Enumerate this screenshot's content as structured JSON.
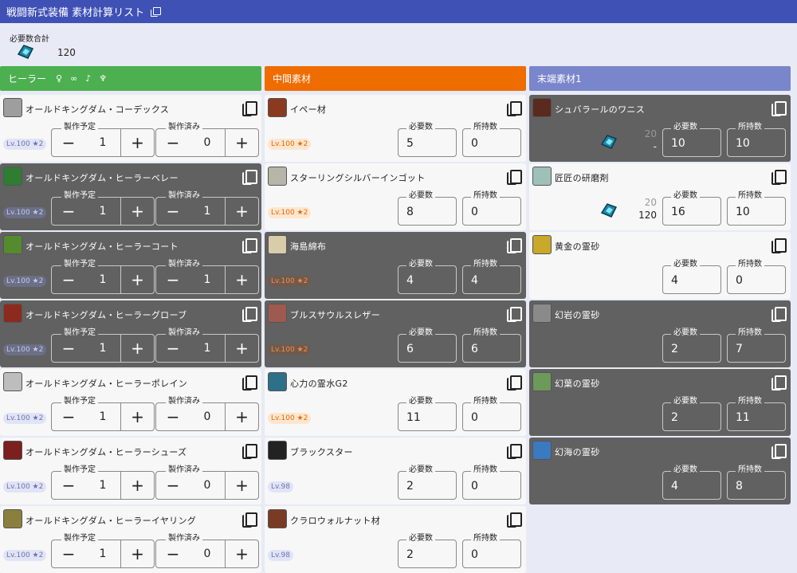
{
  "header": {
    "title": "戦闘新式装備 素材計算リスト"
  },
  "total": {
    "label": "必要数合計",
    "value": "120",
    "icon": "crystal-icon"
  },
  "columns": [
    {
      "title": "ヒーラー",
      "icons": [
        "white-mage-icon",
        "astrologian-icon",
        "sage-icon",
        "scholar-icon"
      ],
      "color": "#4caf50"
    },
    {
      "title": "中間素材",
      "color": "#ef6c00"
    },
    {
      "title": "末端素材1",
      "color": "#7986cb"
    }
  ],
  "gear": [
    {
      "name": "オールドキングダム・コーデックス",
      "level": "Lv.100 ★2",
      "plan_label": "製作予定",
      "plan": "1",
      "done_label": "製作済み",
      "done": "0"
    },
    {
      "name": "オールドキングダム・ヒーラーベレー",
      "level": "Lv.100 ★2",
      "plan_label": "製作予定",
      "plan": "1",
      "done_label": "製作済み",
      "done": "1"
    },
    {
      "name": "オールドキングダム・ヒーラーコート",
      "level": "Lv.100 ★2",
      "plan_label": "製作予定",
      "plan": "1",
      "done_label": "製作済み",
      "done": "1"
    },
    {
      "name": "オールドキングダム・ヒーラーグローブ",
      "level": "Lv.100 ★2",
      "plan_label": "製作予定",
      "plan": "1",
      "done_label": "製作済み",
      "done": "1"
    },
    {
      "name": "オールドキングダム・ヒーラーポレイン",
      "level": "Lv.100 ★2",
      "plan_label": "製作予定",
      "plan": "1",
      "done_label": "製作済み",
      "done": "0"
    },
    {
      "name": "オールドキングダム・ヒーラーシューズ",
      "level": "Lv.100 ★2",
      "plan_label": "製作予定",
      "plan": "1",
      "done_label": "製作済み",
      "done": "0"
    },
    {
      "name": "オールドキングダム・ヒーラーイヤリング",
      "level": "Lv.100 ★2",
      "plan_label": "製作予定",
      "plan": "1",
      "done_label": "製作済み",
      "done": "0"
    }
  ],
  "intermediate": [
    {
      "name": "イペー材",
      "level": "Lv.100 ★2",
      "need_label": "必要数",
      "need": "5",
      "have_label": "所持数",
      "have": "0"
    },
    {
      "name": "スターリングシルバーインゴット",
      "level": "Lv.100 ★2",
      "need_label": "必要数",
      "need": "8",
      "have_label": "所持数",
      "have": "0"
    },
    {
      "name": "海島綿布",
      "level": "Lv.100 ★2",
      "need_label": "必要数",
      "need": "4",
      "have_label": "所持数",
      "have": "4"
    },
    {
      "name": "ブルスサウルスレザー",
      "level": "Lv.100 ★2",
      "need_label": "必要数",
      "need": "6",
      "have_label": "所持数",
      "have": "6"
    },
    {
      "name": "心力の霊水G2",
      "level": "Lv.100 ★2",
      "need_label": "必要数",
      "need": "11",
      "have_label": "所持数",
      "have": "0"
    },
    {
      "name": "ブラックスター",
      "level": "Lv.98",
      "need_label": "必要数",
      "need": "2",
      "have_label": "所持数",
      "have": "0"
    },
    {
      "name": "クラロウォルナット材",
      "level": "Lv.98",
      "need_label": "必要数",
      "need": "2",
      "have_label": "所持数",
      "have": "0"
    }
  ],
  "raw": [
    {
      "name": "シュバラールのワニス",
      "crystal_top": "20",
      "crystal_bottom": "-",
      "need_label": "必要数",
      "need": "10",
      "have_label": "所持数",
      "have": "10"
    },
    {
      "name": "匠匠の研磨剤",
      "crystal_top": "20",
      "crystal_bottom": "120",
      "need_label": "必要数",
      "need": "16",
      "have_label": "所持数",
      "have": "10"
    },
    {
      "name": "黄金の霊砂",
      "need_label": "必要数",
      "need": "4",
      "have_label": "所持数",
      "have": "0"
    },
    {
      "name": "幻岩の霊砂",
      "need_label": "必要数",
      "need": "2",
      "have_label": "所持数",
      "have": "7"
    },
    {
      "name": "幻葉の霊砂",
      "need_label": "必要数",
      "need": "2",
      "have_label": "所持数",
      "have": "11"
    },
    {
      "name": "幻海の霊砂",
      "need_label": "必要数",
      "need": "4",
      "have_label": "所持数",
      "have": "8"
    }
  ]
}
